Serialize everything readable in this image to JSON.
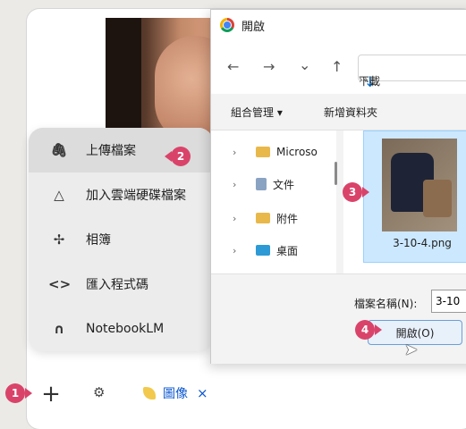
{
  "menu": {
    "items": [
      {
        "label": "上傳檔案",
        "icon": "paperclip-icon",
        "glyph": "🖇"
      },
      {
        "label": "加入雲端硬碟檔案",
        "icon": "drive-icon",
        "glyph": "△"
      },
      {
        "label": "相簿",
        "icon": "pinwheel-icon",
        "glyph": "✢"
      },
      {
        "label": "匯入程式碼",
        "icon": "code-icon",
        "glyph": "<>"
      },
      {
        "label": "NotebookLM",
        "icon": "notebooklm-icon",
        "glyph": "∩"
      }
    ]
  },
  "bottombar": {
    "plus": "+",
    "tools_glyph": "⚙",
    "image_chip_label": "圖像",
    "image_chip_close": "×"
  },
  "dialog": {
    "title": "開啟",
    "nav": {
      "back": "←",
      "forward": "→",
      "recent": "⌄",
      "up": "↑",
      "download_glyph": "↓",
      "path": "下載",
      "sep": "›"
    },
    "toolbar": {
      "organize": "組合管理 ▾",
      "new_folder": "新增資料夾"
    },
    "tree": [
      {
        "label": "Microso",
        "color": "#e8b84a"
      },
      {
        "label": "文件",
        "color": "#8aa3c2"
      },
      {
        "label": "附件",
        "color": "#e8b84a"
      },
      {
        "label": "桌面",
        "color": "#2d9ad6"
      }
    ],
    "file_name": "3-10-4.png",
    "filename_label": "檔案名稱(N):",
    "filename_value": "3-10",
    "open_button": "開啟(O)"
  },
  "badges": [
    "1",
    "2",
    "3",
    "4"
  ],
  "colors": {
    "badge": "#d9436a",
    "selection": "#cce8ff",
    "accent": "#0067c0"
  }
}
